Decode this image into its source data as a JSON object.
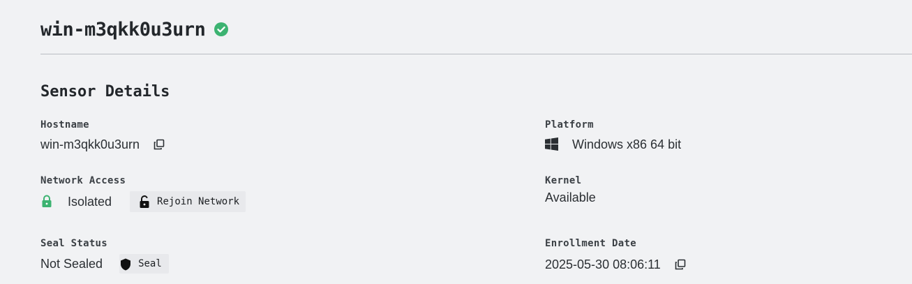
{
  "header": {
    "hostname": "win-m3qkk0u3urn",
    "status_icon": "check-circle-icon",
    "status_color": "#3cb371"
  },
  "section": {
    "title": "Sensor Details"
  },
  "fields": {
    "hostname": {
      "label": "Hostname",
      "value": "win-m3qkk0u3urn",
      "icon": "copy-icon"
    },
    "network_access": {
      "label": "Network Access",
      "value": "Isolated",
      "status_icon": "lock-icon",
      "status_color": "#3cb371",
      "action_label": "Rejoin Network",
      "action_icon": "unlock-icon"
    },
    "seal_status": {
      "label": "Seal Status",
      "value": "Not Sealed",
      "action_label": "Seal",
      "action_icon": "shield-icon"
    },
    "platform": {
      "label": "Platform",
      "value": "Windows x86 64 bit",
      "icon": "windows-icon"
    },
    "kernel": {
      "label": "Kernel",
      "value": "Available"
    },
    "enrollment_date": {
      "label": "Enrollment Date",
      "value": "2025-05-30 08:06:11",
      "icon": "copy-icon"
    }
  }
}
